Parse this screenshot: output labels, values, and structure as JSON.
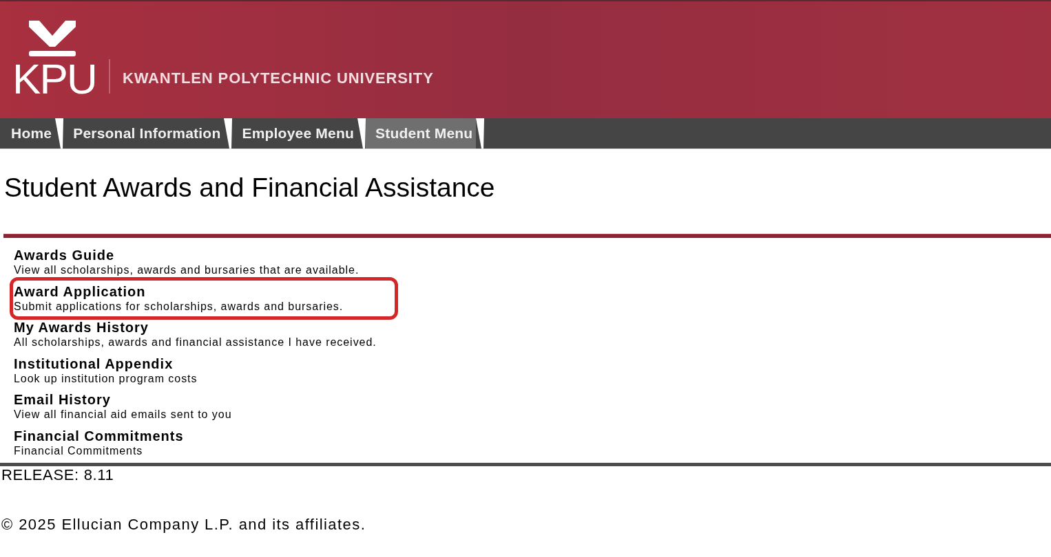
{
  "header": {
    "logo_text": "KPU",
    "institution": "KWANTLEN POLYTECHNIC UNIVERSITY"
  },
  "nav": {
    "tabs": [
      {
        "label": "Home",
        "selected": false
      },
      {
        "label": "Personal Information",
        "selected": false
      },
      {
        "label": "Employee Menu",
        "selected": false
      },
      {
        "label": "Student Menu",
        "selected": true
      }
    ]
  },
  "page_title": "Student Awards and Financial Assistance",
  "menu_items": [
    {
      "title": "Awards Guide",
      "description": "View all scholarships, awards and bursaries that are available.",
      "highlighted": false
    },
    {
      "title": "Award Application",
      "description": "Submit applications for scholarships, awards and bursaries.",
      "highlighted": true
    },
    {
      "title": "My Awards History",
      "description": "All scholarships, awards and financial assistance I have received.",
      "highlighted": false
    },
    {
      "title": "Institutional Appendix",
      "description": "Look up institution program costs",
      "highlighted": false
    },
    {
      "title": "Email History",
      "description": "View all financial aid emails sent to you",
      "highlighted": false
    },
    {
      "title": "Financial Commitments",
      "description": "Financial Commitments",
      "highlighted": false
    }
  ],
  "footer": {
    "release": "RELEASE: 8.11",
    "copyright": "© 2025 Ellucian Company L.P. and its affiliates."
  }
}
